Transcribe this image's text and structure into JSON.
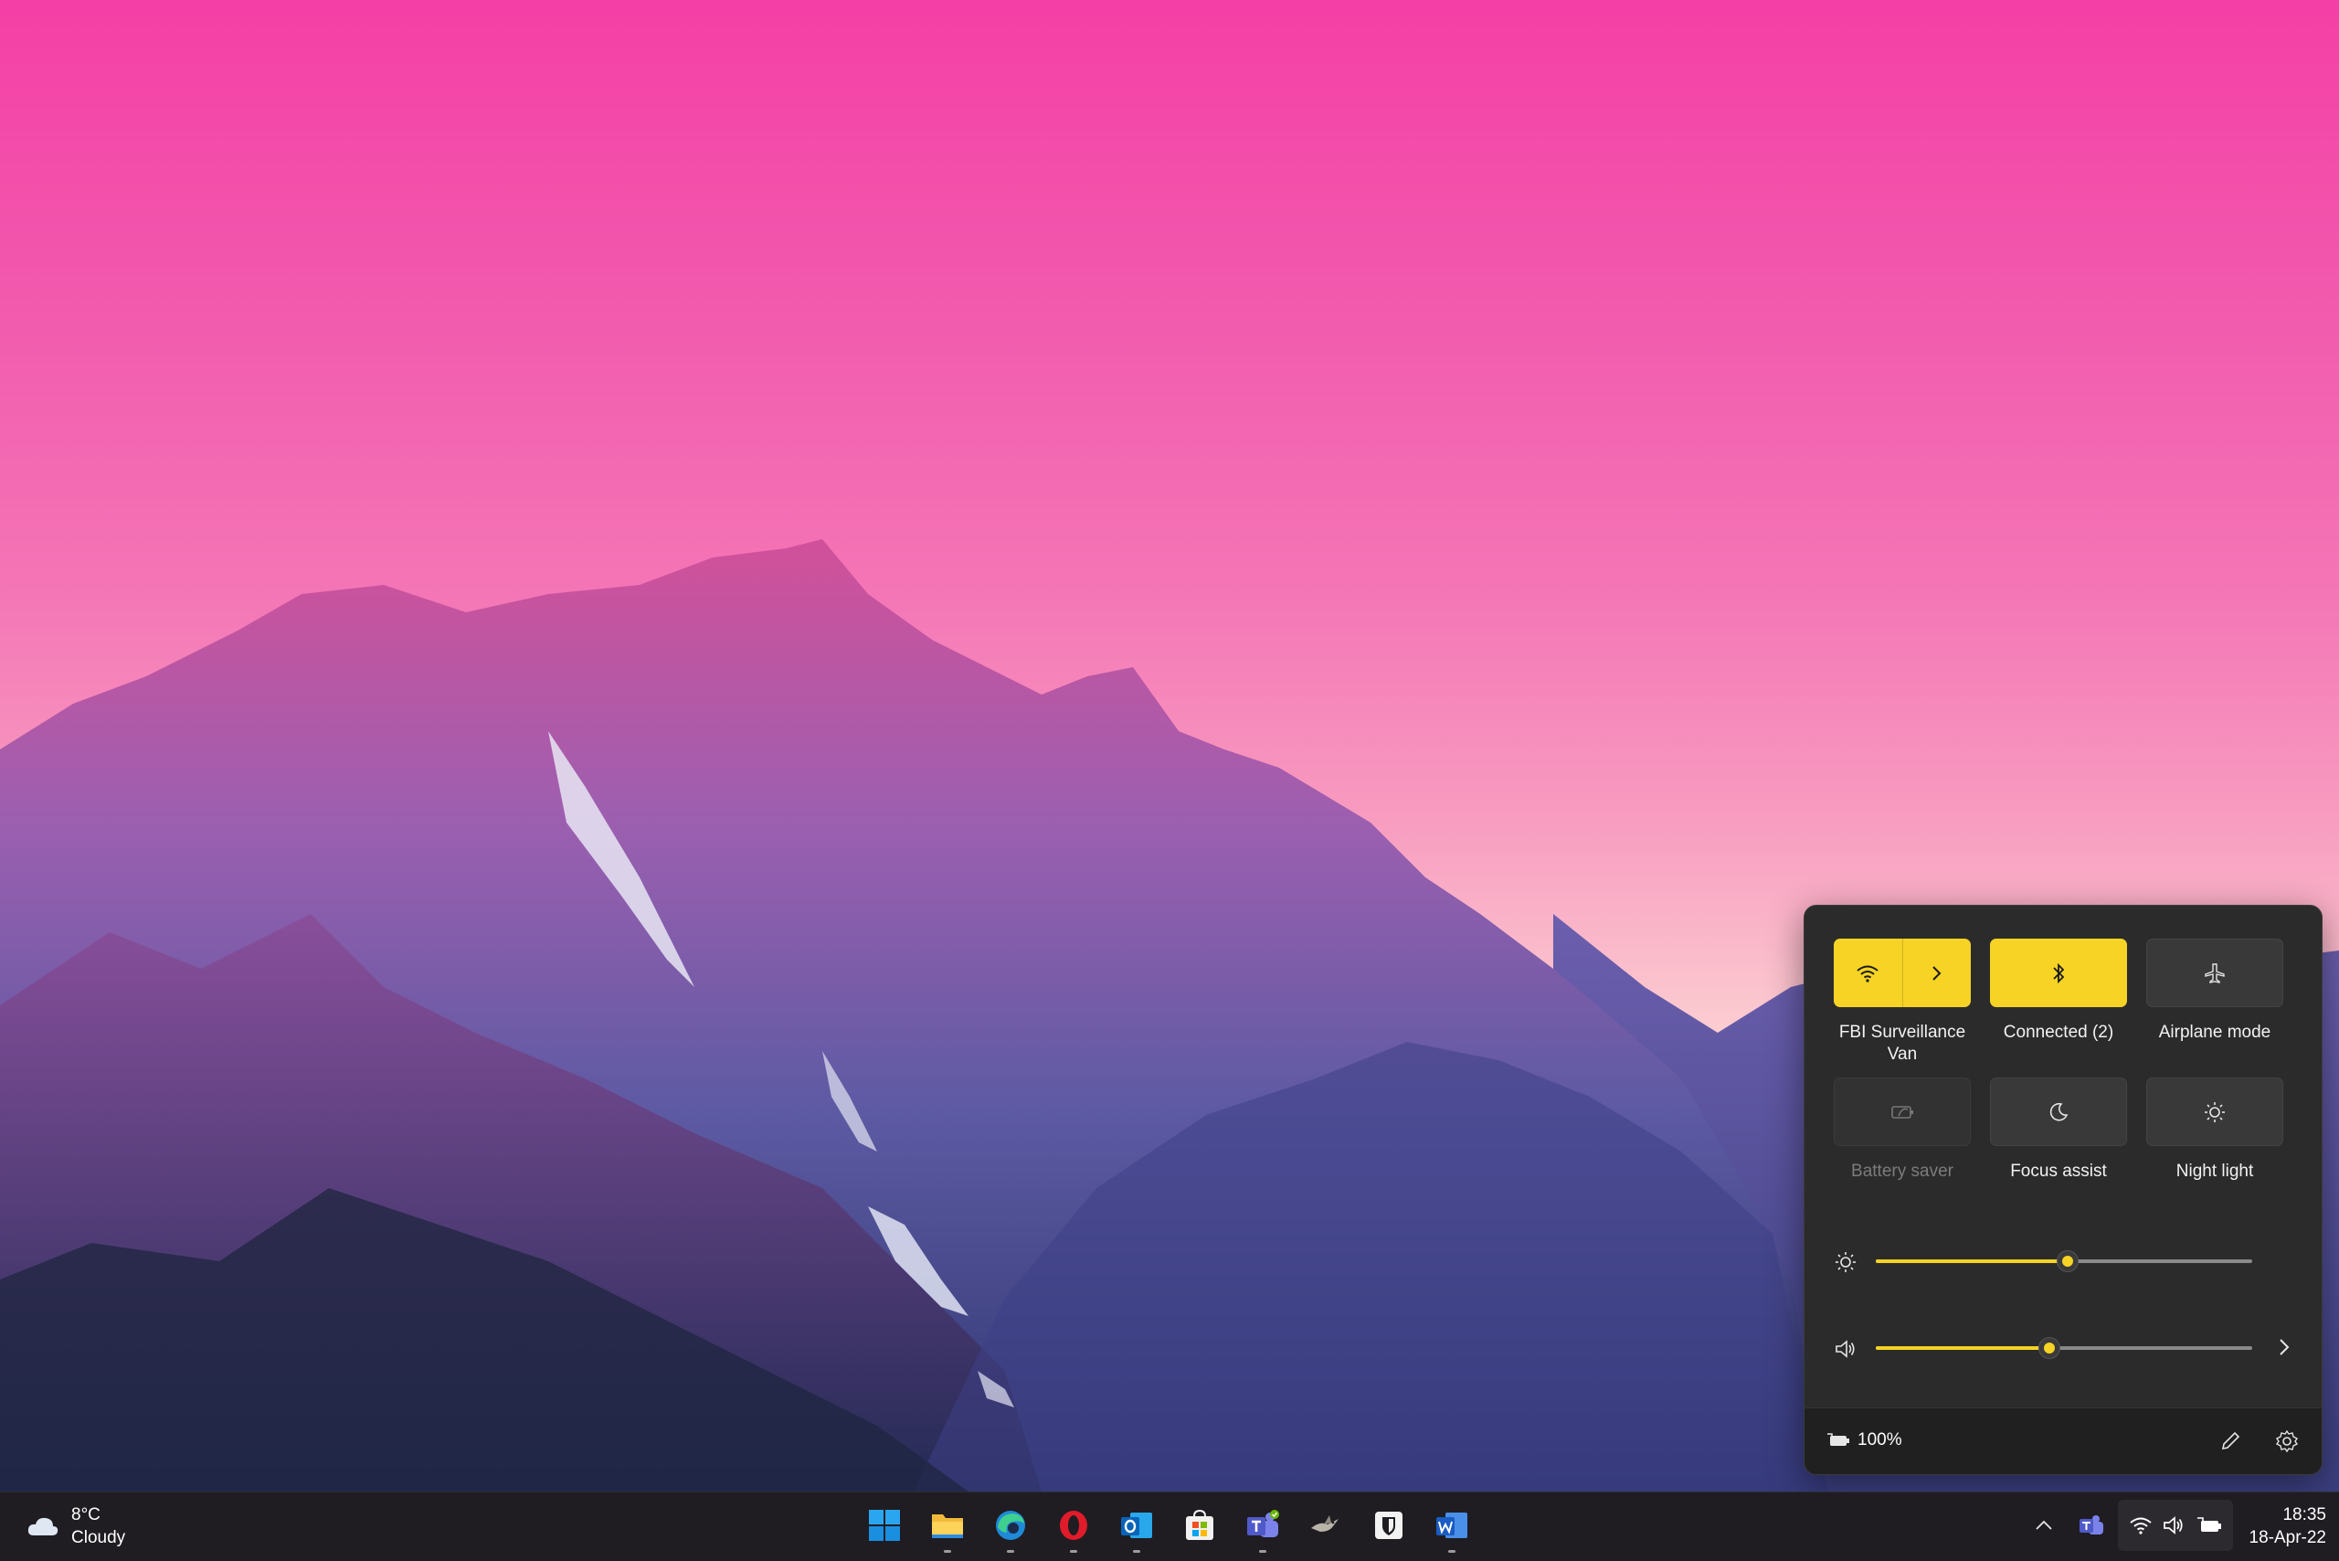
{
  "quick_settings": {
    "tiles": [
      {
        "id": "wifi",
        "label": "FBI Surveillance Van",
        "state": "on",
        "icon": "wifi-icon"
      },
      {
        "id": "bluetooth",
        "label": "Connected (2)",
        "state": "on",
        "icon": "bluetooth-icon"
      },
      {
        "id": "airplane",
        "label": "Airplane mode",
        "state": "off",
        "icon": "airplane-icon"
      },
      {
        "id": "battery_saver",
        "label": "Battery saver",
        "state": "disabled",
        "icon": "battery-saver-icon"
      },
      {
        "id": "focus_assist",
        "label": "Focus assist",
        "state": "off",
        "icon": "moon-icon"
      },
      {
        "id": "night_light",
        "label": "Night light",
        "state": "off",
        "icon": "sun-icon"
      }
    ],
    "brightness_level": 0.51,
    "volume_level": 0.46,
    "battery_percent": "100%",
    "accent_color": "#f6d325"
  },
  "taskbar": {
    "weather": {
      "temp": "8°C",
      "condition": "Cloudy",
      "icon": "cloud-icon"
    },
    "apps": [
      {
        "name": "Start",
        "icon": "windows-start-icon",
        "open": false
      },
      {
        "name": "File Explorer",
        "icon": "file-explorer-icon",
        "open": true
      },
      {
        "name": "Microsoft Edge",
        "icon": "edge-icon",
        "open": true
      },
      {
        "name": "Opera",
        "icon": "opera-icon",
        "open": true
      },
      {
        "name": "Outlook",
        "icon": "outlook-icon",
        "open": true
      },
      {
        "name": "Microsoft Store",
        "icon": "store-icon",
        "open": false
      },
      {
        "name": "Microsoft Teams",
        "icon": "teams-icon",
        "open": true
      },
      {
        "name": "App",
        "icon": "bird-app-icon",
        "open": false
      },
      {
        "name": "Bitwarden",
        "icon": "shield-app-icon",
        "open": false
      },
      {
        "name": "Word",
        "icon": "word-icon",
        "open": true
      }
    ],
    "clock": {
      "time": "18:35",
      "date": "18-Apr-22"
    }
  }
}
